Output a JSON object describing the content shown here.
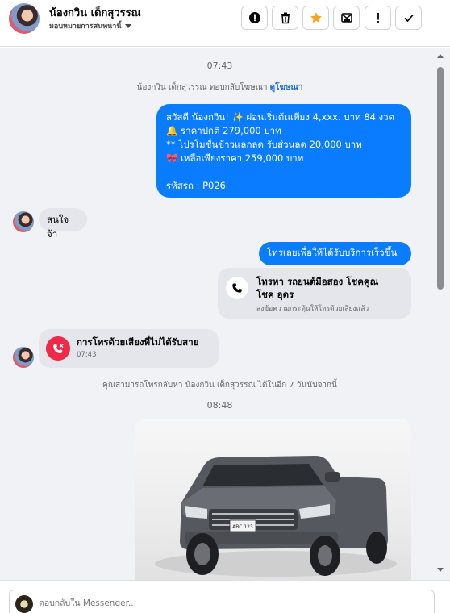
{
  "header": {
    "contact_name": "น้องกวิน เด็กสุวรรณ",
    "contact_subtitle": "มอบหมายการสนทนานี้",
    "actions": [
      {
        "icon": "alert-circle-icon",
        "label": "spam"
      },
      {
        "icon": "trash-icon",
        "label": "delete"
      },
      {
        "icon": "star-icon",
        "label": "star"
      },
      {
        "icon": "mail-icon",
        "label": "mark-unread"
      },
      {
        "icon": "exclamation-icon",
        "label": "follow-up"
      },
      {
        "icon": "check-icon",
        "label": "done"
      }
    ]
  },
  "colors": {
    "accent": "#0a7cff",
    "star": "#f5a623",
    "missed": "#f02849",
    "link": "#1f6fd1"
  },
  "messages": {
    "time_1": "07:43",
    "ad_reply_text": "น้องกวิน เด็กสุวรรณ ตอบกลับโฆษณา",
    "ad_reply_link": "ดูโฆษณา",
    "promo": {
      "line1": "สวัสดี น้องกวิน! ✨  ผ่อนเริ่มต้นเพียง 4,xxx. บาท 84 งวด",
      "line2": "🔔 ราคาปกติ 279,000 บาท",
      "line3": "** โปรโมชั่นข้าวแลกลด รับส่วนลด 20,000 บาท",
      "line4": "🎀  เหลือเพียงราคา 259,000 บาท",
      "line5": "รหัสรถ : P026"
    },
    "incoming_1": "สนใจจ้า",
    "outgoing_call_request": "โทรเลยเพื่อให้ได้รับบริการเร็วขึ้น",
    "call_card": {
      "title_line1": "โทรหา รถยนต์มือสอง โชคคูณ",
      "title_line2": "โชค อุดร",
      "subtitle": "ส่งข้อความกระตุ้นให้โทรด้วยเสียงแล้ว"
    },
    "missed_call": {
      "title": "การโทรด้วยเสียงที่ไม่ได้รับสาย",
      "time": "07:43"
    },
    "callback_note": "คุณสามารถโทรกลับหา น้องกวิน เด็กสุวรรณ ได้ในอีก 7 วันนับจากนี้",
    "time_2": "08:48"
  },
  "composer": {
    "placeholder": "ตอบกลับใน Messenger..."
  }
}
